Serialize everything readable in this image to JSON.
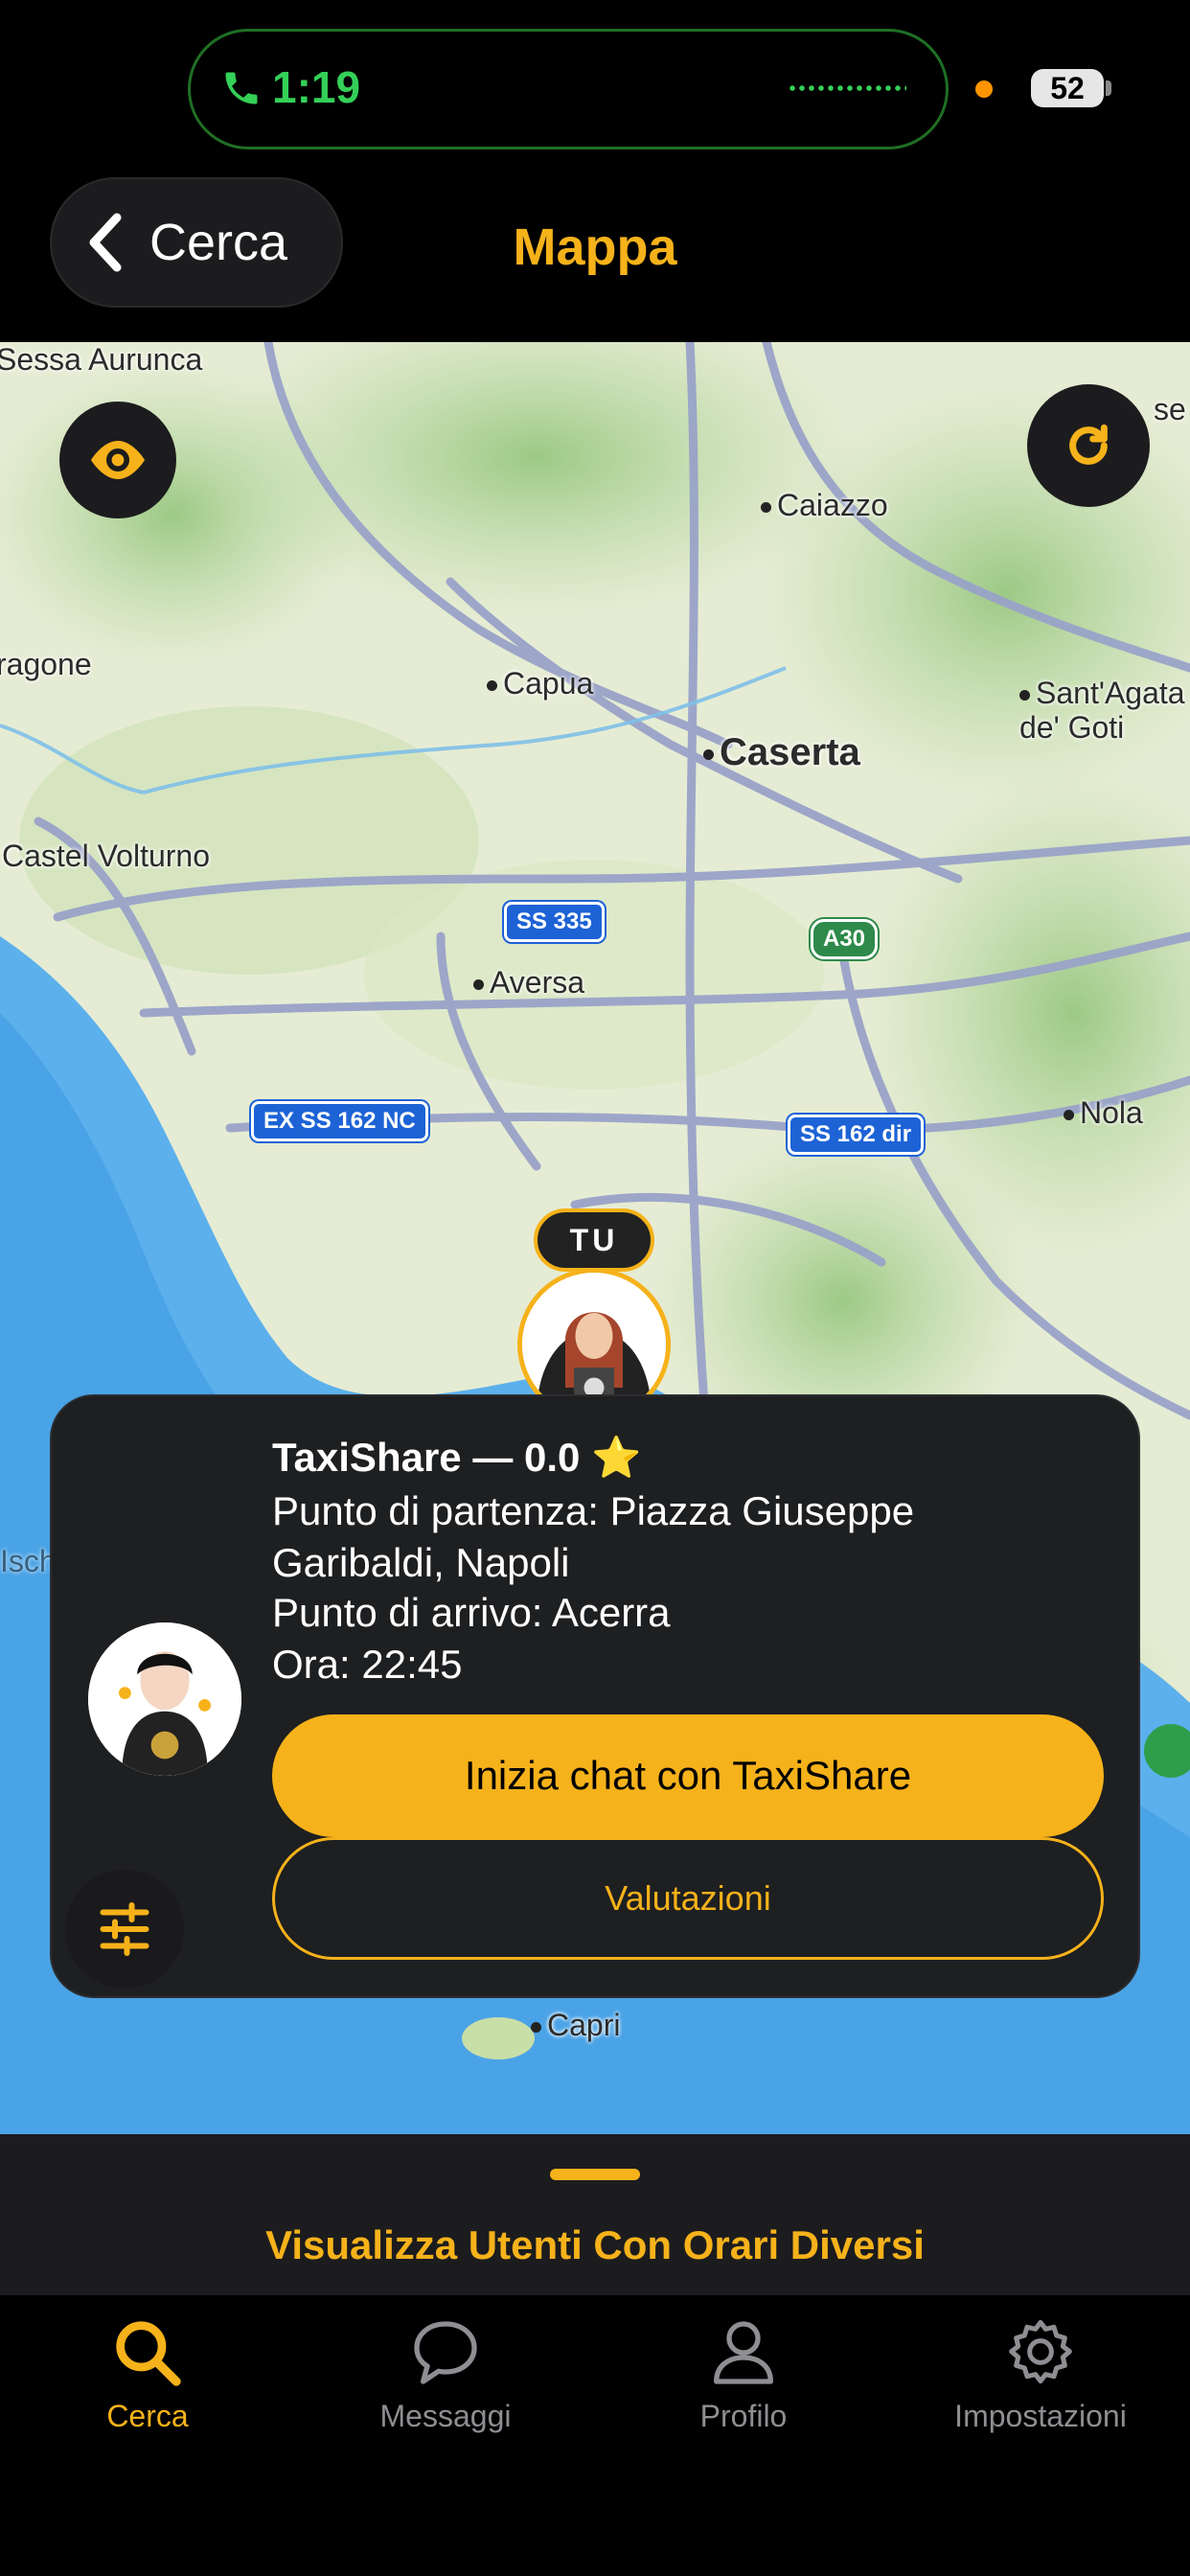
{
  "status_bar": {
    "time": "1:19",
    "battery": "52"
  },
  "header": {
    "back_label": "Cerca",
    "title": "Mappa"
  },
  "map": {
    "places": [
      {
        "name": "Sessa Aurunca",
        "size": "normal"
      },
      {
        "name": "Caiazzo",
        "size": "normal"
      },
      {
        "name": "ragone",
        "size": "normal"
      },
      {
        "name": "Capua",
        "size": "normal"
      },
      {
        "name": "Sant'Agata de' Goti",
        "size": "normal"
      },
      {
        "name": "Caserta",
        "size": "big"
      },
      {
        "name": "Castel Volturno",
        "size": "normal"
      },
      {
        "name": "Aversa",
        "size": "normal"
      },
      {
        "name": "Nola",
        "size": "normal"
      },
      {
        "name": "Capri",
        "size": "normal"
      },
      {
        "name": "se",
        "size": "normal"
      }
    ],
    "shields": [
      "SS 335",
      "A30",
      "EX SS 162 NC",
      "SS 162 dir"
    ],
    "user_marker_label": "TU"
  },
  "card": {
    "title": "TaxiShare — 0.0 ⭐",
    "departure_line1": "Punto di partenza: Piazza Giuseppe",
    "departure_line2": "Garibaldi, Napoli",
    "arrival": "Punto di arrivo: Acerra",
    "time": "Ora: 22:45",
    "chat_button": "Inizia chat con TaxiShare",
    "ratings_button": "Valutazioni"
  },
  "drawer": {
    "label": "Visualizza Utenti Con Orari Diversi"
  },
  "tabs": [
    {
      "label": "Cerca",
      "icon": "search-icon",
      "active": true
    },
    {
      "label": "Messaggi",
      "icon": "chat-bubble-icon",
      "active": false
    },
    {
      "label": "Profilo",
      "icon": "person-icon",
      "active": false
    },
    {
      "label": "Impostazioni",
      "icon": "gear-icon",
      "active": false
    }
  ],
  "colors": {
    "accent": "#f6b21a",
    "background": "#000000",
    "card": "#1e1f21",
    "call_green": "#34d058"
  }
}
